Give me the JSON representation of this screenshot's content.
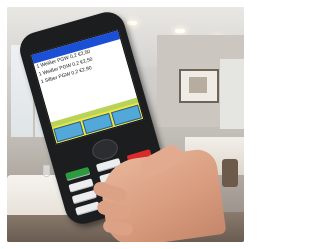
{
  "scene": {
    "description_colors": {
      "screen_title_bar": "#1b4fd6",
      "screen_bottom": "#f2e53a",
      "softkeys": "#52a8d8",
      "phone_body": "#1c1d1f",
      "end_key": "#d92b2b"
    }
  },
  "device_screen": {
    "title": "",
    "order_lines": [
      "1 Weißer PGW 0,2 €2,50",
      "1 Weißer PGW 0,2 €2,50",
      "1 Silber PGW 0,2 €2,90"
    ],
    "softkeys": [
      "",
      "",
      ""
    ]
  }
}
